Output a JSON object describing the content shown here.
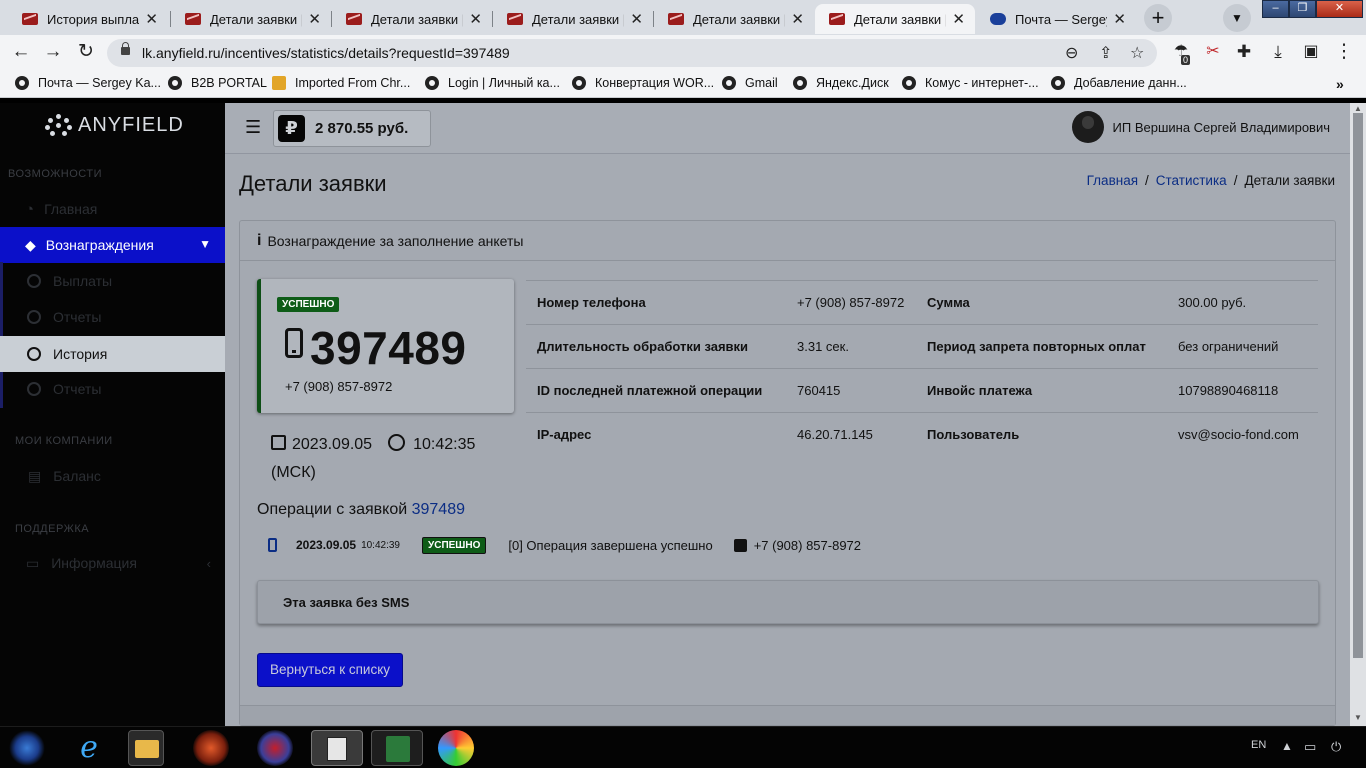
{
  "browser": {
    "tabs": [
      {
        "title": "История выплат | Л"
      },
      {
        "title": "Детали заявки | Л"
      },
      {
        "title": "Детали заявки | Л"
      },
      {
        "title": "Детали заявки | Л"
      },
      {
        "title": "Детали заявки | Л"
      },
      {
        "title": "Детали заявки | Л"
      },
      {
        "title": "Почта — Sergey K"
      }
    ],
    "url": "lk.anyfield.ru/incentives/statistics/details?requestId=397489",
    "bookmarks": [
      "Почта — Sergey Ka...",
      "B2B PORTAL",
      "Imported From Chr...",
      "Login | Личный ка...",
      "Конвертация WOR...",
      "Gmail",
      "Яндекс.Диск",
      "Комус - интернет-...",
      "Добавление данн..."
    ],
    "extension_badge": "0"
  },
  "sidebar": {
    "logo": "ANYFIELD",
    "section1": "ВОЗМОЖНОСТИ",
    "main_item": "Главная",
    "rewards": "Вознаграждения",
    "sub": [
      "Выплаты",
      "Отчеты",
      "История",
      "Отчеты"
    ],
    "section2": "МОИ КОМПАНИИ",
    "item_balance": "Баланс",
    "section3": "ПОДДЕРЖКА",
    "item_info": "Информация"
  },
  "topbar": {
    "currency_icon": "₽",
    "balance": "2 870.55 руб.",
    "user_name": "ИП Вершина Сергей Владимирович"
  },
  "page": {
    "title": "Детали заявки",
    "breadcrumb": {
      "home": "Главная",
      "stats": "Статистика",
      "current": "Детали заявки"
    }
  },
  "card": {
    "header": "Вознаграждение за заполнение анкеты",
    "status": "УСПЕШНО",
    "request_id": "397489",
    "phone": "+7 (908) 857-8972",
    "date": "2023.09.05",
    "time": "10:42:35",
    "tz": "(МСК)",
    "details": [
      {
        "label": "Номер телефона",
        "value": "+7 (908) 857-8972",
        "label2": "Сумма",
        "value2": "300.00 руб."
      },
      {
        "label": "Длительность обработки заявки",
        "value": "3.31 сек.",
        "label2": "Период запрета повторных оплат",
        "value2": "без ограничений"
      },
      {
        "label": "ID последней платежной операции",
        "value": "760415",
        "label2": "Инвойс платежа",
        "value2": "10798890468118"
      },
      {
        "label": "IP-адрес",
        "value": "46.20.71.145",
        "label2": "Пользователь",
        "value2": "vsv@socio-fond.com"
      }
    ],
    "ops_title": "Операции с заявкой",
    "ops_id": "397489",
    "op": {
      "date": "2023.09.05",
      "time": "10:42:39",
      "status": "УСПЕШНО",
      "message": "[0] Операция завершена успешно",
      "phone": "+7 (908) 857-8972"
    },
    "no_sms": "Эта заявка без SMS",
    "back_button": "Вернуться к списку"
  },
  "taskbar": {
    "lang": "EN"
  },
  "colors": {
    "accent": "#0b10c9",
    "success": "#0e5c17",
    "link": "#0b2d84"
  }
}
